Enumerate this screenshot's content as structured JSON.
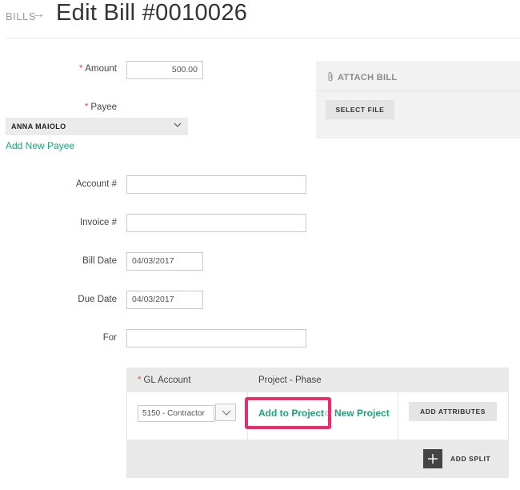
{
  "header": {
    "breadcrumb": "BILLS",
    "breadcrumb_arrow": "→",
    "title": "Edit Bill #0010026"
  },
  "form": {
    "required_mark": "*",
    "amount_label": "Amount",
    "amount_value": "500.00",
    "payee_label": "Payee",
    "payee_value": "ANNA MAIOLO",
    "add_new_payee": "Add New Payee",
    "account_label": "Account #",
    "account_value": "",
    "invoice_label": "Invoice #",
    "invoice_value": "",
    "bill_date_label": "Bill Date",
    "bill_date_value": "04/03/2017",
    "due_date_label": "Due Date",
    "due_date_value": "04/03/2017",
    "for_label": "For",
    "for_value": ""
  },
  "attach": {
    "title": "ATTACH BILL",
    "select_file": "SELECT FILE"
  },
  "gl_table": {
    "col_gl_account": "GL Account",
    "col_project_phase": "Project - Phase",
    "gl_value": "5150 - Contractor",
    "add_to_project": "Add to Project",
    "or": "or",
    "new_project": "New Project",
    "add_attributes": "ADD ATTRIBUTES",
    "add_split": "ADD SPLIT"
  },
  "colors": {
    "accent_green": "#1ba37a",
    "highlight_pink": "#ee2c6b",
    "required_red": "#d9534f"
  }
}
